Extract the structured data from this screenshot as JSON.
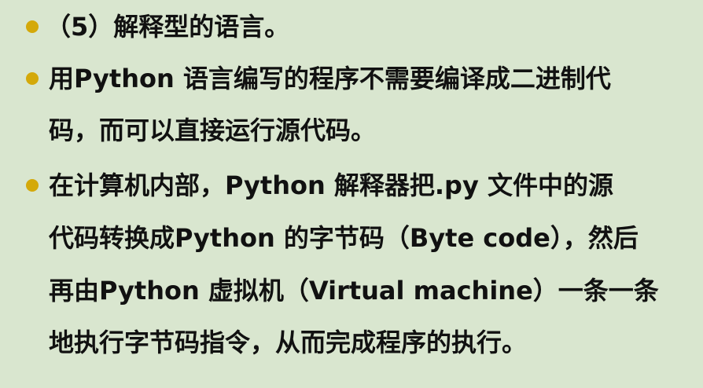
{
  "slide": {
    "bullets": [
      {
        "lines": [
          "（5）解释型的语言。"
        ]
      },
      {
        "lines": [
          "用Python 语言编写的程序不需要编译成二进制代",
          "码，而可以直接运行源代码。"
        ]
      },
      {
        "lines": [
          "在计算机内部，Python 解释器把.py 文件中的源",
          "代码转换成Python 的字节码（Byte code），然后",
          "再由Python 虚拟机（Virtual machine）一条一条",
          "地执行字节码指令，从而完成程序的执行。"
        ]
      }
    ],
    "colors": {
      "background": "#d9e6cf",
      "bullet": "#d4a90a",
      "text": "#111111"
    }
  }
}
